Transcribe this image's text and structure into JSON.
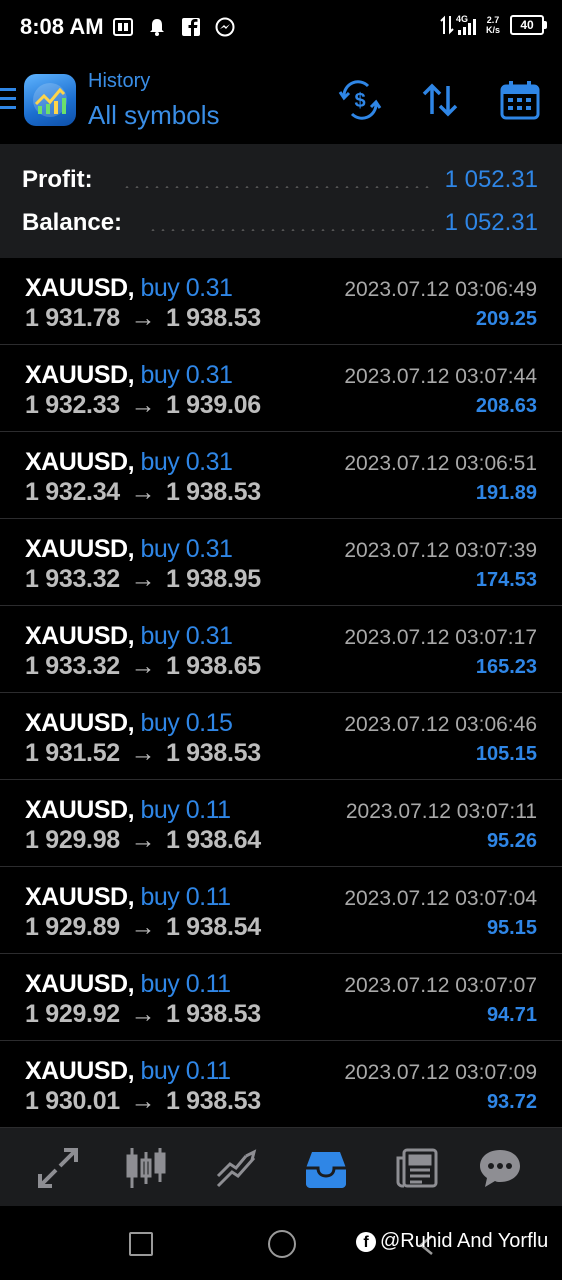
{
  "status_bar": {
    "time": "8:08 AM",
    "network": "4G",
    "speed_value": "2.7",
    "speed_unit": "K/s",
    "battery": "40",
    "icons": [
      "pd-icon",
      "bell-icon",
      "facebook-icon",
      "messenger-icon"
    ]
  },
  "header": {
    "subtitle": "History",
    "title": "All symbols",
    "actions": [
      "currency-swap-icon",
      "sort-icon",
      "calendar-icon"
    ]
  },
  "summary": {
    "profit_label": "Profit:",
    "profit_value": "1 052.31",
    "balance_label": "Balance:",
    "balance_value": "1 052.31"
  },
  "trades": [
    {
      "symbol": "XAUUSD,",
      "side": "buy 0.31",
      "open": "1 931.78",
      "arrow": "→",
      "close": "1 938.53",
      "time": "2023.07.12 03:06:49",
      "profit": "209.25"
    },
    {
      "symbol": "XAUUSD,",
      "side": "buy 0.31",
      "open": "1 932.33",
      "arrow": "→",
      "close": "1 939.06",
      "time": "2023.07.12 03:07:44",
      "profit": "208.63"
    },
    {
      "symbol": "XAUUSD,",
      "side": "buy 0.31",
      "open": "1 932.34",
      "arrow": "→",
      "close": "1 938.53",
      "time": "2023.07.12 03:06:51",
      "profit": "191.89"
    },
    {
      "symbol": "XAUUSD,",
      "side": "buy 0.31",
      "open": "1 933.32",
      "arrow": "→",
      "close": "1 938.95",
      "time": "2023.07.12 03:07:39",
      "profit": "174.53"
    },
    {
      "symbol": "XAUUSD,",
      "side": "buy 0.31",
      "open": "1 933.32",
      "arrow": "→",
      "close": "1 938.65",
      "time": "2023.07.12 03:07:17",
      "profit": "165.23"
    },
    {
      "symbol": "XAUUSD,",
      "side": "buy 0.15",
      "open": "1 931.52",
      "arrow": "→",
      "close": "1 938.53",
      "time": "2023.07.12 03:06:46",
      "profit": "105.15"
    },
    {
      "symbol": "XAUUSD,",
      "side": "buy 0.11",
      "open": "1 929.98",
      "arrow": "→",
      "close": "1 938.64",
      "time": "2023.07.12 03:07:11",
      "profit": "95.26"
    },
    {
      "symbol": "XAUUSD,",
      "side": "buy 0.11",
      "open": "1 929.89",
      "arrow": "→",
      "close": "1 938.54",
      "time": "2023.07.12 03:07:04",
      "profit": "95.15"
    },
    {
      "symbol": "XAUUSD,",
      "side": "buy 0.11",
      "open": "1 929.92",
      "arrow": "→",
      "close": "1 938.53",
      "time": "2023.07.12 03:07:07",
      "profit": "94.71"
    },
    {
      "symbol": "XAUUSD,",
      "side": "buy 0.11",
      "open": "1 930.01",
      "arrow": "→",
      "close": "1 938.53",
      "time": "2023.07.12 03:07:09",
      "profit": "93.72"
    }
  ],
  "bottom_nav": {
    "items": [
      "quotes-icon",
      "chart-icon",
      "trade-icon",
      "history-icon",
      "news-icon",
      "chat-icon"
    ],
    "active": "history-icon"
  },
  "watermark": {
    "text": "@Ruhid And Yorflu",
    "icon": "facebook-icon"
  },
  "colors": {
    "accent": "#2f86e6",
    "background": "#000000",
    "panel": "#1b1c1e",
    "secondary_text": "#a9a9a9"
  }
}
